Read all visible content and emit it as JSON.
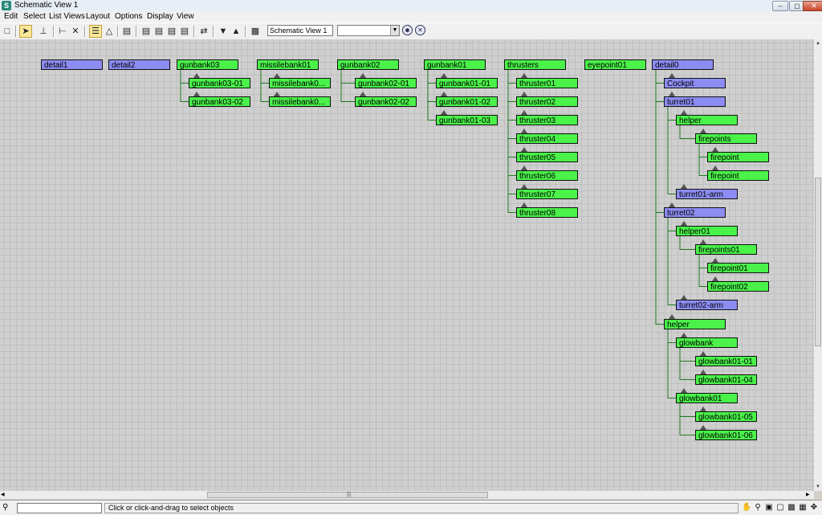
{
  "window": {
    "title": "Schematic View 1",
    "app_icon": "S"
  },
  "menu": [
    "Edit",
    "Select",
    "List Views",
    "Layout",
    "Options",
    "Display",
    "View"
  ],
  "toolbar": {
    "view_name": "Schematic View 1",
    "filter_value": ""
  },
  "status": {
    "message": "Click or click-and-drag to select objects"
  },
  "nodes": [
    {
      "label": "detail1",
      "color": "blue"
    },
    {
      "label": "detail2",
      "color": "blue"
    },
    {
      "label": "gunbank03",
      "color": "green"
    },
    {
      "label": "gunbank03-01",
      "color": "green"
    },
    {
      "label": "gunbank03-02",
      "color": "green"
    },
    {
      "label": "missilebank01",
      "color": "green"
    },
    {
      "label": "missilebank0...",
      "color": "green"
    },
    {
      "label": "missilebank0...",
      "color": "green"
    },
    {
      "label": "gunbank02",
      "color": "green"
    },
    {
      "label": "gunbank02-01",
      "color": "green"
    },
    {
      "label": "gunbank02-02",
      "color": "green"
    },
    {
      "label": "gunbank01",
      "color": "green"
    },
    {
      "label": "gunbank01-01",
      "color": "green"
    },
    {
      "label": "gunbank01-02",
      "color": "green"
    },
    {
      "label": "gunbank01-03",
      "color": "green"
    },
    {
      "label": "thrusters",
      "color": "green"
    },
    {
      "label": "thruster01",
      "color": "green"
    },
    {
      "label": "thruster02",
      "color": "green"
    },
    {
      "label": "thruster03",
      "color": "green"
    },
    {
      "label": "thruster04",
      "color": "green"
    },
    {
      "label": "thruster05",
      "color": "green"
    },
    {
      "label": "thruster06",
      "color": "green"
    },
    {
      "label": "thruster07",
      "color": "green"
    },
    {
      "label": "thruster08",
      "color": "green"
    },
    {
      "label": "eyepoint01",
      "color": "green"
    },
    {
      "label": "detail0",
      "color": "blue"
    },
    {
      "label": "Cockpit",
      "color": "blue"
    },
    {
      "label": "turret01",
      "color": "blue"
    },
    {
      "label": "helper",
      "color": "green"
    },
    {
      "label": "firepoints",
      "color": "green"
    },
    {
      "label": "firepoint",
      "color": "green"
    },
    {
      "label": "firepoint",
      "color": "green"
    },
    {
      "label": "turret01-arm",
      "color": "blue"
    },
    {
      "label": "turret02",
      "color": "blue"
    },
    {
      "label": "helper01",
      "color": "green"
    },
    {
      "label": "firepoints01",
      "color": "green"
    },
    {
      "label": "firepoint01",
      "color": "green"
    },
    {
      "label": "firepoint02",
      "color": "green"
    },
    {
      "label": "turret02-arm",
      "color": "blue"
    },
    {
      "label": "helper",
      "color": "green"
    },
    {
      "label": "glowbank",
      "color": "green"
    },
    {
      "label": "glowbank01-01",
      "color": "green"
    },
    {
      "label": "glowbank01-04",
      "color": "green"
    },
    {
      "label": "glowbank01",
      "color": "green"
    },
    {
      "label": "glowbank01-05",
      "color": "green"
    },
    {
      "label": "glowbank01-06",
      "color": "green"
    }
  ],
  "links": [
    [
      2,
      3
    ],
    [
      2,
      4
    ],
    [
      5,
      6
    ],
    [
      5,
      7
    ],
    [
      8,
      9
    ],
    [
      8,
      10
    ],
    [
      11,
      12
    ],
    [
      11,
      13
    ],
    [
      11,
      14
    ],
    [
      15,
      16
    ],
    [
      15,
      17
    ],
    [
      15,
      18
    ],
    [
      15,
      19
    ],
    [
      15,
      20
    ],
    [
      15,
      21
    ],
    [
      15,
      22
    ],
    [
      15,
      23
    ],
    [
      25,
      26
    ],
    [
      25,
      27
    ],
    [
      25,
      33
    ],
    [
      25,
      39
    ],
    [
      27,
      28
    ],
    [
      27,
      32
    ],
    [
      28,
      29
    ],
    [
      29,
      30
    ],
    [
      29,
      31
    ],
    [
      33,
      34
    ],
    [
      33,
      38
    ],
    [
      34,
      35
    ],
    [
      35,
      36
    ],
    [
      35,
      37
    ],
    [
      39,
      40
    ],
    [
      39,
      43
    ],
    [
      40,
      41
    ],
    [
      40,
      42
    ],
    [
      43,
      44
    ],
    [
      43,
      45
    ]
  ],
  "colors": {
    "node_green": "#4af24a",
    "node_blue": "#8c8cf2",
    "wire": "#1f7a1f",
    "grid": "#c0c0c0"
  }
}
